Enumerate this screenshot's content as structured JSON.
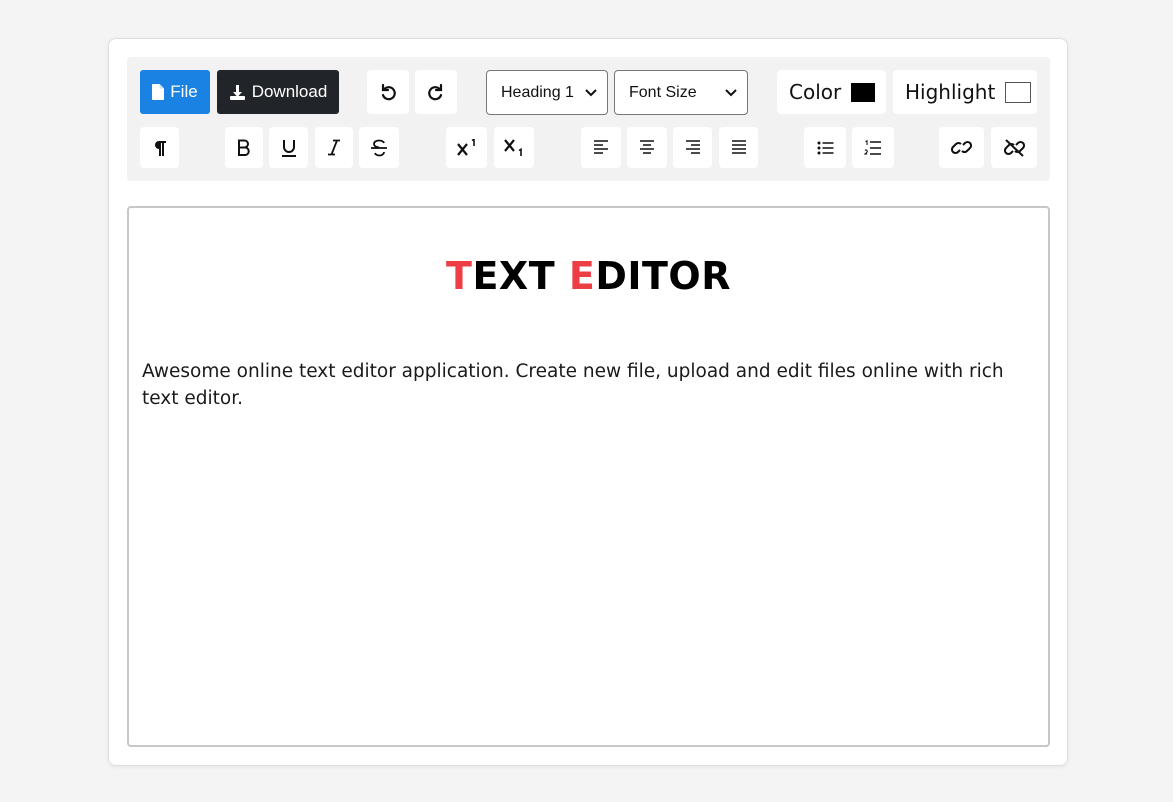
{
  "toolbar": {
    "file_label": "File",
    "download_label": "Download",
    "block_format": "Heading 1",
    "font_size": "Font Size",
    "color_label": "Color",
    "highlight_label": "Highlight",
    "color_value": "#000000",
    "highlight_value": "#ffffff",
    "accent_color": "#1a82e2",
    "dark_button_color": "#212529"
  },
  "editor": {
    "title_parts": [
      "T",
      "EXT ",
      "E",
      "DITOR"
    ],
    "title_accent_color": "#ee3e45",
    "body": "Awesome online text editor application. Create new file, upload and edit files online with rich text editor."
  }
}
